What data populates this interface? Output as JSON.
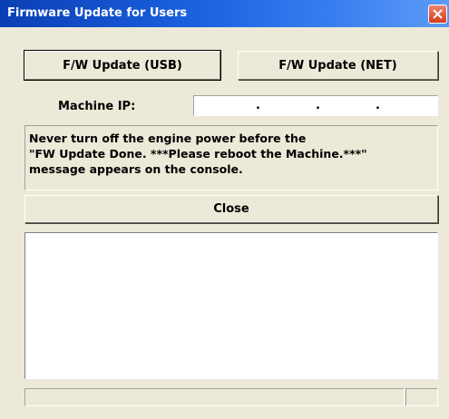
{
  "window": {
    "title": "Firmware Update for Users",
    "close_icon": "close-x-icon"
  },
  "buttons": {
    "usb_label": "F/W Update (USB)",
    "net_label": "F/W Update (NET)",
    "close_label": "Close"
  },
  "machine_ip": {
    "label": "Machine IP:",
    "octets": [
      "",
      "",
      "",
      ""
    ],
    "separator": "."
  },
  "warning": {
    "lines": [
      "Never turn off the engine power before the",
      "\"FW Update Done. ***Please reboot the Machine.***\"",
      "message appears on the console."
    ]
  },
  "log": {
    "content": ""
  },
  "status": {
    "main": "",
    "side": ""
  },
  "colors": {
    "titlebar_start": "#0a3fb4",
    "titlebar_end": "#5b9bf7",
    "dialog_bg": "#ece9d8",
    "close_button": "#d63a1a"
  }
}
